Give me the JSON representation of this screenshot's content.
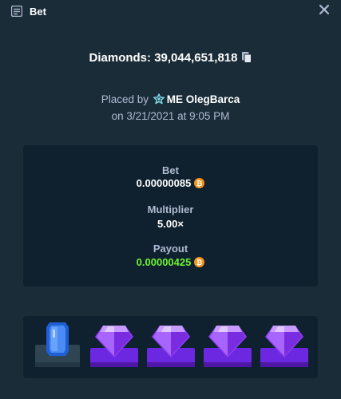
{
  "header": {
    "title": "Bet",
    "icon": "bet-slip-icon",
    "close_icon": "close-icon"
  },
  "result": {
    "game_label": "Diamonds:",
    "bet_id": "39,044,651,818",
    "copy_icon": "copy-icon"
  },
  "placed": {
    "prefix": "Placed by",
    "vip_icon": "star-badge-icon",
    "username": "ME OlegBarca",
    "date": "on 3/21/2021 at 9:05 PM"
  },
  "stats": {
    "bet_label": "Bet",
    "bet_value": "0.00000085",
    "multiplier_label": "Multiplier",
    "multiplier_value": "5.00×",
    "payout_label": "Payout",
    "payout_value": "0.00000425",
    "currency_icon": "bitcoin-icon"
  },
  "tiles": [
    {
      "gem": "blue-gem",
      "highlighted": false
    },
    {
      "gem": "purple-gem",
      "highlighted": true
    },
    {
      "gem": "purple-gem",
      "highlighted": true
    },
    {
      "gem": "purple-gem",
      "highlighted": true
    },
    {
      "gem": "purple-gem",
      "highlighted": true
    }
  ],
  "colors": {
    "background": "#1a2c38",
    "panel": "#0f212e",
    "muted_text": "#b1bad3",
    "payout_green": "#6ff230",
    "bitcoin": "#f7931a",
    "vip": "#7fd9e6",
    "highlight_platform": "#6c28e0",
    "plain_platform": "#2f4553"
  }
}
